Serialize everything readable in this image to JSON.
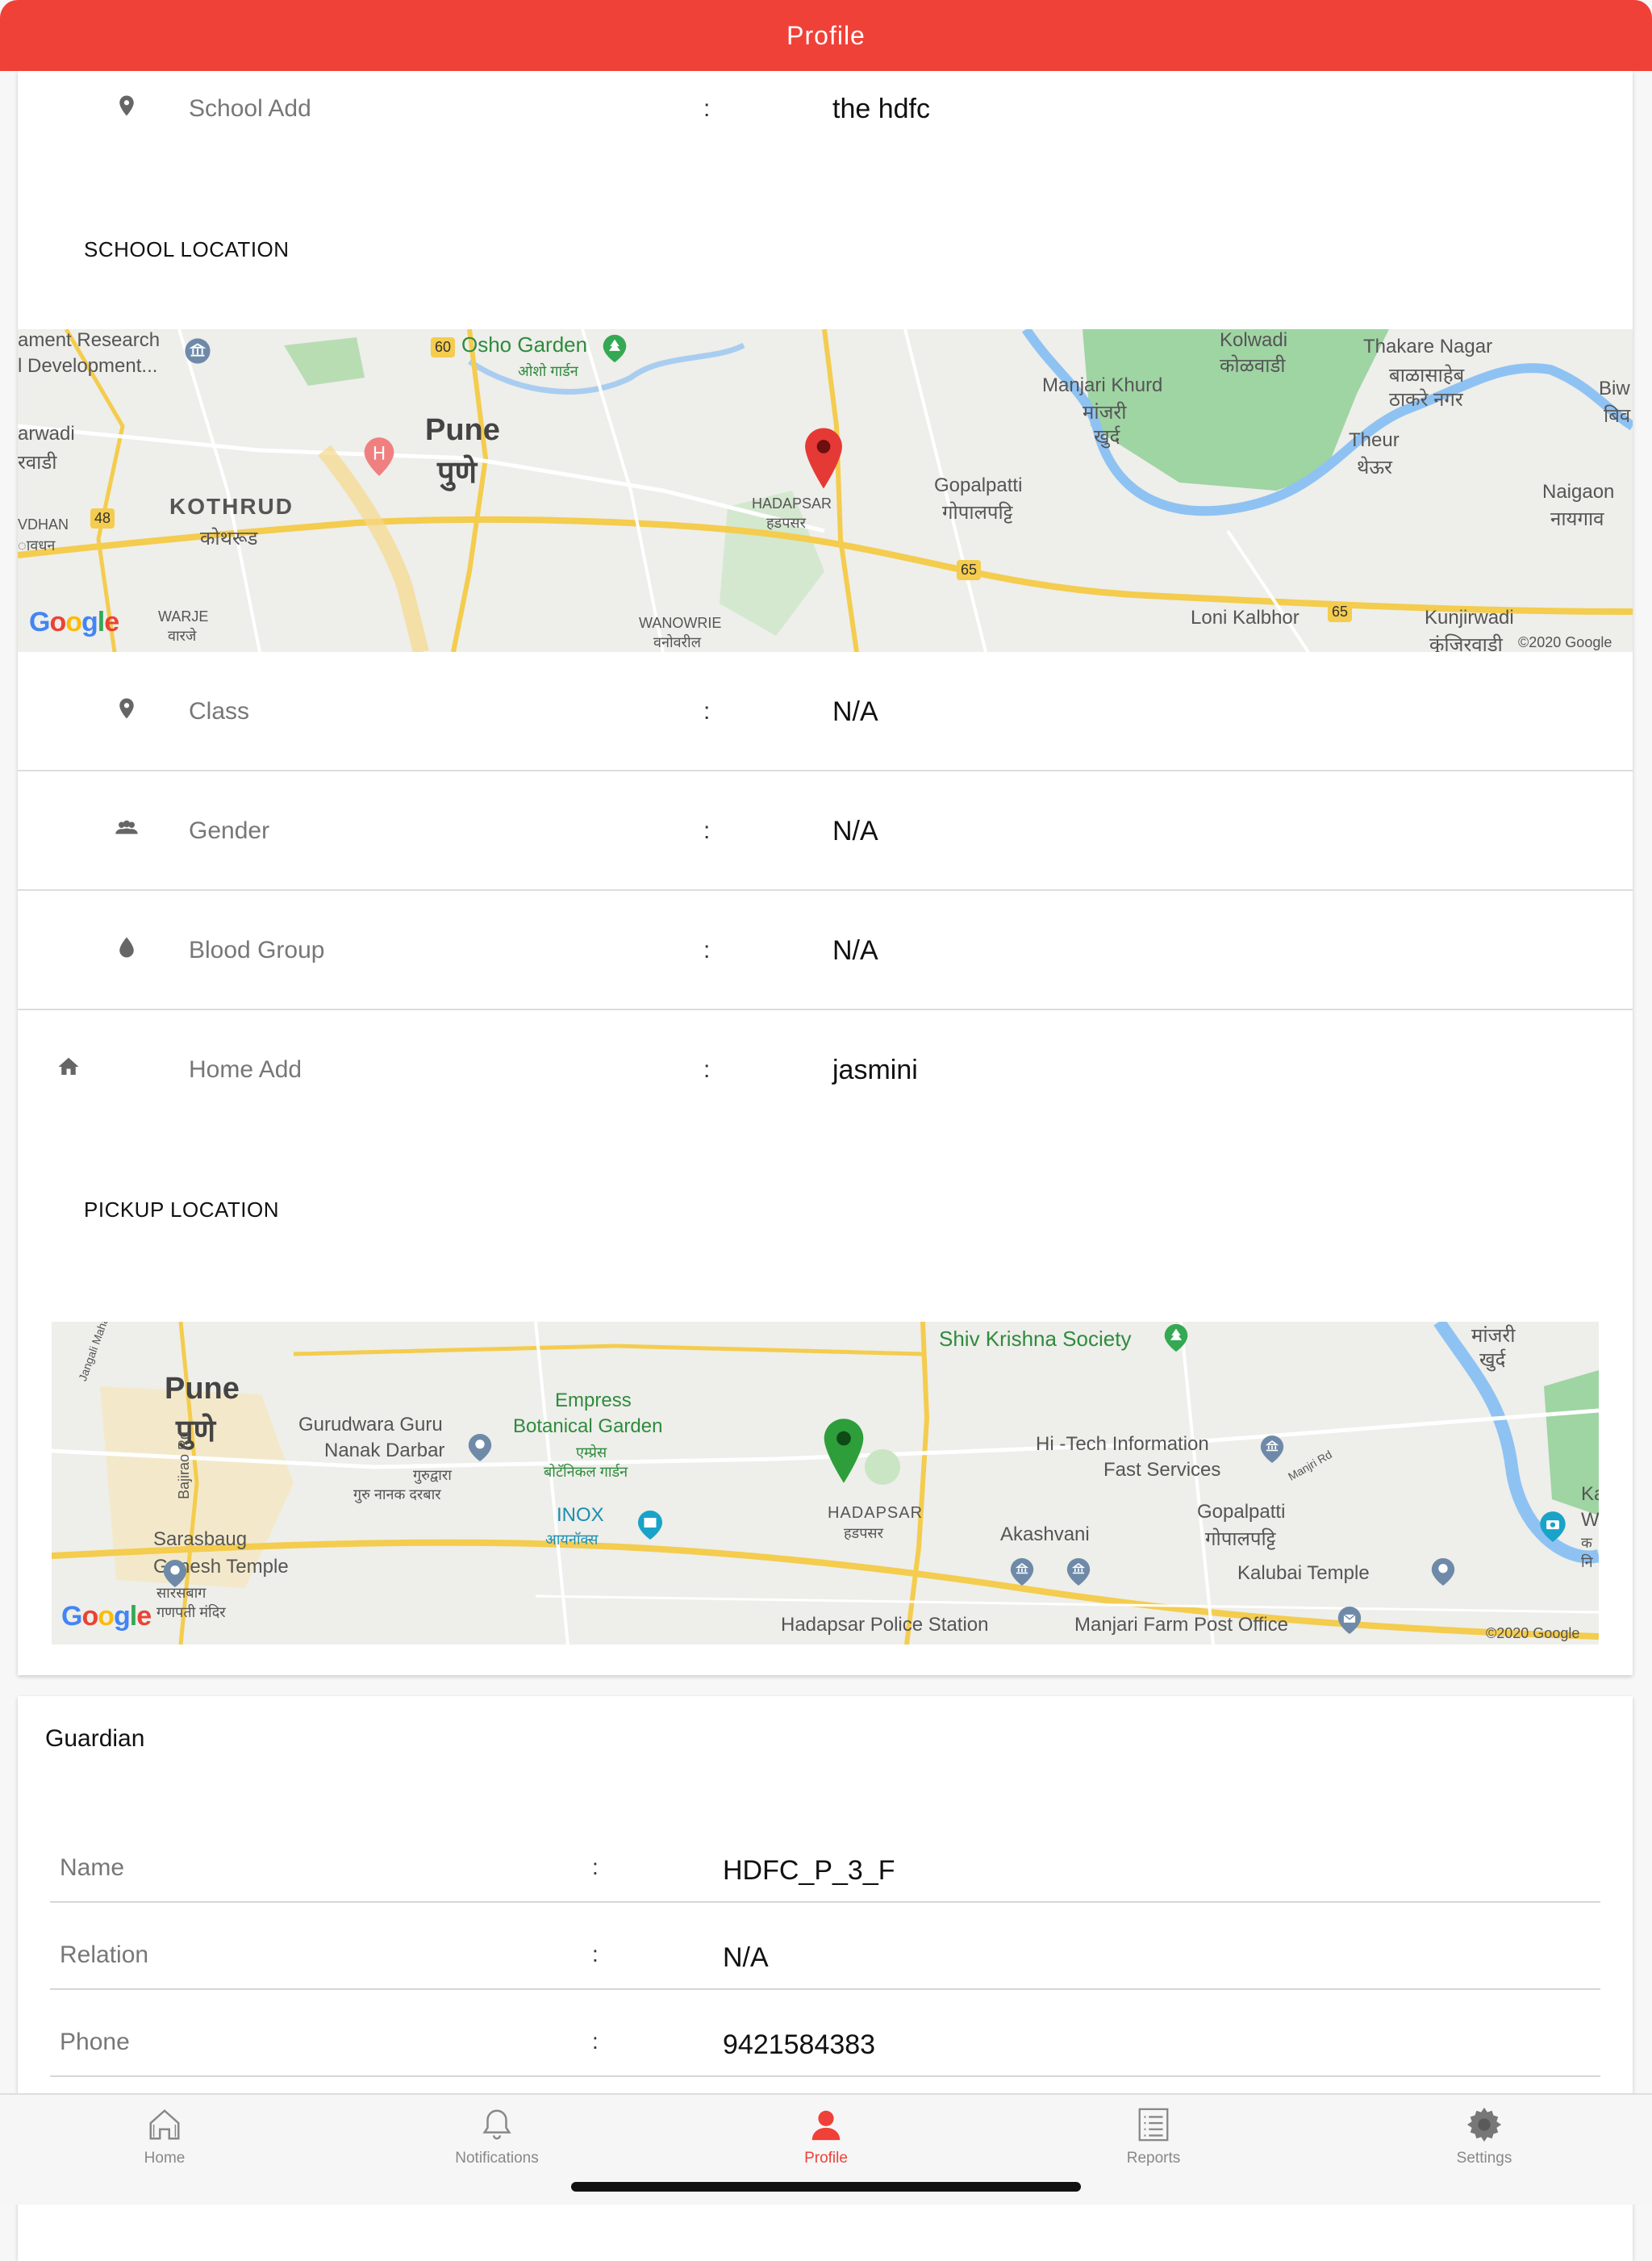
{
  "header": {
    "title": "Profile"
  },
  "student": {
    "school_add": {
      "label": "School Add",
      "value": "the hdfc",
      "icon": "location-pin-icon"
    },
    "school_location_title": "SCHOOL LOCATION",
    "class": {
      "label": "Class",
      "value": "N/A",
      "icon": "location-pin-icon"
    },
    "gender": {
      "label": "Gender",
      "value": "N/A",
      "icon": "people-icon"
    },
    "blood_group": {
      "label": "Blood Group",
      "value": "N/A",
      "icon": "drop-icon"
    },
    "home_add": {
      "label": "Home Add",
      "value": "jasmini",
      "icon": "home-icon"
    },
    "pickup_location_title": "PICKUP LOCATION",
    "colon": ":"
  },
  "school_map": {
    "labels": {
      "research": "ament Research",
      "development": "l Development...",
      "osho": "Osho Garden",
      "osho_mr": "ओशो गार्डन",
      "pune": "Pune",
      "pune_mr": "पुणे",
      "arwadi": "arwadi",
      "arwadi_mr": "रवाडी",
      "kothrud": "KOTHRUD",
      "kothrud_mr": "कोथरूड",
      "vdhan": "VDHAN",
      "vdhan_mr": "ावधन",
      "warje": "WARJE",
      "warje_mr": "वारजे",
      "hadapsar": "HADAPSAR",
      "hadapsar_mr": "हडपसर",
      "wanowrie": "WANOWRIE",
      "wanowrie_mr": "वनोवरील",
      "kolwadi": "Kolwadi",
      "kolwadi_mr": "कोळवाडी",
      "thakare": "Thakare Nagar",
      "thakare_mr1": "बाळासाहेब",
      "thakare_mr2": "ठाकरे नगर",
      "biw": "Biw",
      "biw_mr": "बिव",
      "manjari": "Manjari Khurd",
      "manjari_mr1": "मांजरी",
      "manjari_mr2": "खुर्द",
      "theur": "Theur",
      "theur_mr": "थेऊर",
      "gopalpatti": "Gopalpatti",
      "gopalpatti_mr": "गोपालपट्टि",
      "naigaon": "Naigaon",
      "naigaon_mr": "नायगाव",
      "loni": "Loni Kalbhor",
      "kunjirwadi": "Kunjirwadi",
      "kunjirwadi_mr": "कुंजिरवाडी",
      "shield_60": "60",
      "shield_48": "48",
      "shield_65a": "65",
      "shield_65b": "65",
      "copyright": "©2020 Google"
    },
    "marker_color": "#e53935"
  },
  "pickup_map": {
    "labels": {
      "shiv": "Shiv Krishna Society",
      "manjari_mr1": "मांजरी",
      "manjari_mr2": "खुर्द",
      "pune": "Pune",
      "pune_mr": "पुणे",
      "jangali": "Jangali Maharaj Rd",
      "gurudwara1": "Gurudwara Guru",
      "gurudwara2": "Nanak Darbar",
      "gurudwara_mr1": "गुरुद्वारा",
      "gurudwara_mr2": "गुरु नानक दरबार",
      "empress1": "Empress",
      "empress2": "Botanical Garden",
      "empress_mr1": "एम्प्रेस",
      "empress_mr2": "बोटॅनिकल गार्डन",
      "hitech1": "Hi -Tech Information",
      "hitech2": "Fast Services",
      "manjri_rd": "Manjri Rd",
      "ka": "Ka",
      "w": "W",
      "ka_mr": "क",
      "ni_mr": "नि",
      "bajirao": "Bajirao Rd",
      "inox": "INOX",
      "inox_mr": "आयनॉक्स",
      "hadapsar": "HADAPSAR",
      "hadapsar_mr": "हडपसर",
      "akashvani": "Akashvani",
      "gopalpatti": "Gopalpatti",
      "gopalpatti_mr": "गोपालपट्टि",
      "sarasbaug1": "Sarasbaug",
      "sarasbaug2": "Ganesh Temple",
      "sarasbaug_mr1": "सारसबाग",
      "sarasbaug_mr2": "गणपती मंदिर",
      "kalubai": "Kalubai Temple",
      "police": "Hadapsar Police Station",
      "post": "Manjari Farm Post Office",
      "copyright": "©2020 Google"
    },
    "marker_color": "#2e9e3a"
  },
  "google_logo": "Google",
  "guardian": {
    "title": "Guardian",
    "rows": [
      {
        "label": "Name",
        "value": "HDFC_P_3_F"
      },
      {
        "label": "Relation",
        "value": "N/A"
      },
      {
        "label": "Phone",
        "value": "9421584383"
      }
    ],
    "colon": ":"
  },
  "tabs": [
    {
      "label": "Home",
      "icon": "home-outline-icon",
      "active": false
    },
    {
      "label": "Notifications",
      "icon": "bell-icon",
      "active": false
    },
    {
      "label": "Profile",
      "icon": "person-icon",
      "active": true
    },
    {
      "label": "Reports",
      "icon": "list-icon",
      "active": false
    },
    {
      "label": "Settings",
      "icon": "gear-icon",
      "active": false
    }
  ],
  "colors": {
    "accent": "#ef4138",
    "inactive_tab": "#888888"
  }
}
